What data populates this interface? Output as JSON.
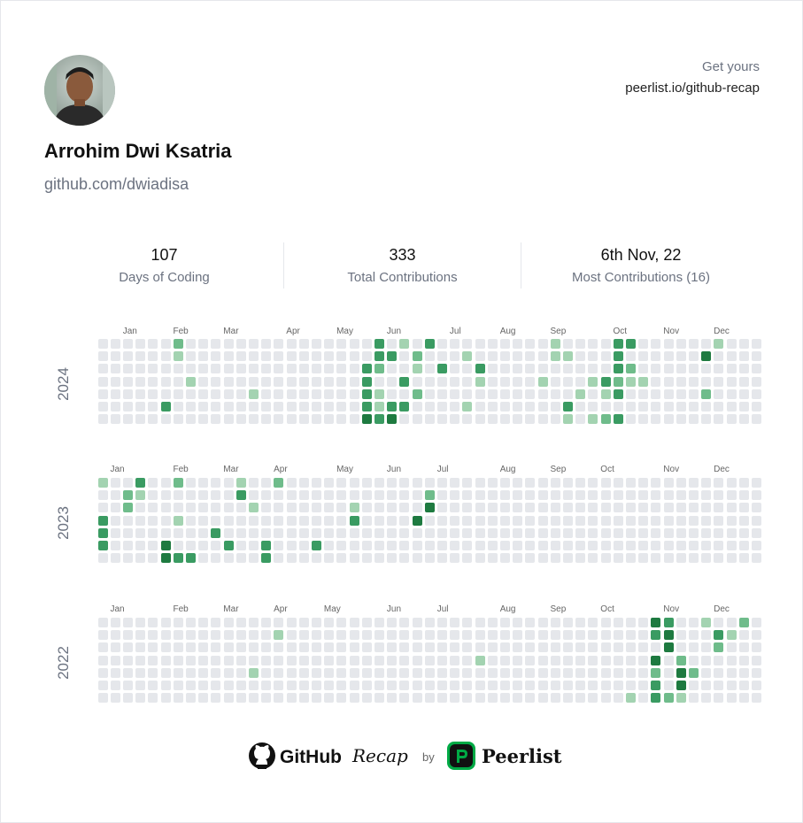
{
  "profile": {
    "name": "Arrohim Dwi Ksatria",
    "handle": "github.com/dwiadisa"
  },
  "promo": {
    "line1": "Get yours",
    "line2": "peerlist.io/github-recap"
  },
  "stats": [
    {
      "value": "107",
      "label": "Days of Coding"
    },
    {
      "value": "333",
      "label": "Total Contributions"
    },
    {
      "value": "6th Nov, 22",
      "label": "Most Contributions (16)"
    }
  ],
  "colors": {
    "empty": "#e5e7eb",
    "level1": "#a3d3b1",
    "level2": "#6fbc8b",
    "level3": "#3a9b62",
    "level4": "#1e7a40",
    "peerlist_green": "#00aa45"
  },
  "footer": {
    "github": "GitHub",
    "recap": "Recap",
    "by": "by",
    "peerlist": "Peerlist"
  },
  "years": [
    {
      "year": "2024",
      "months": [
        {
          "label": "Jan",
          "col": 1
        },
        {
          "label": "Feb",
          "col": 5
        },
        {
          "label": "Mar",
          "col": 9
        },
        {
          "label": "Apr",
          "col": 14
        },
        {
          "label": "May",
          "col": 18
        },
        {
          "label": "Jun",
          "col": 22
        },
        {
          "label": "Jul",
          "col": 27
        },
        {
          "label": "Aug",
          "col": 31
        },
        {
          "label": "Sep",
          "col": 35
        },
        {
          "label": "Oct",
          "col": 40
        },
        {
          "label": "Nov",
          "col": 44
        },
        {
          "label": "Dec",
          "col": 48
        }
      ],
      "active": [
        [
          0,
          6,
          2
        ],
        [
          1,
          6,
          1
        ],
        [
          5,
          5,
          3
        ],
        [
          3,
          7,
          1
        ],
        [
          4,
          12,
          1
        ],
        [
          0,
          22,
          3
        ],
        [
          1,
          22,
          3
        ],
        [
          2,
          21,
          3
        ],
        [
          3,
          21,
          3
        ],
        [
          4,
          21,
          3
        ],
        [
          5,
          21,
          3
        ],
        [
          6,
          21,
          4
        ],
        [
          2,
          22,
          2
        ],
        [
          4,
          22,
          1
        ],
        [
          5,
          22,
          1
        ],
        [
          6,
          22,
          3
        ],
        [
          1,
          23,
          3
        ],
        [
          5,
          23,
          3
        ],
        [
          6,
          23,
          4
        ],
        [
          3,
          24,
          3
        ],
        [
          0,
          24,
          1
        ],
        [
          5,
          24,
          3
        ],
        [
          1,
          25,
          2
        ],
        [
          2,
          25,
          1
        ],
        [
          4,
          25,
          2
        ],
        [
          0,
          26,
          3
        ],
        [
          2,
          27,
          3
        ],
        [
          1,
          29,
          1
        ],
        [
          5,
          29,
          1
        ],
        [
          2,
          30,
          3
        ],
        [
          3,
          30,
          1
        ],
        [
          3,
          35,
          1
        ],
        [
          0,
          36,
          1
        ],
        [
          1,
          36,
          1
        ],
        [
          5,
          37,
          3
        ],
        [
          6,
          37,
          1
        ],
        [
          1,
          37,
          1
        ],
        [
          4,
          38,
          1
        ],
        [
          3,
          39,
          1
        ],
        [
          6,
          39,
          1
        ],
        [
          4,
          40,
          1
        ],
        [
          6,
          40,
          2
        ],
        [
          3,
          40,
          3
        ],
        [
          0,
          41,
          3
        ],
        [
          1,
          41,
          3
        ],
        [
          2,
          41,
          3
        ],
        [
          3,
          41,
          2
        ],
        [
          4,
          41,
          3
        ],
        [
          6,
          41,
          3
        ],
        [
          0,
          42,
          3
        ],
        [
          2,
          42,
          2
        ],
        [
          3,
          42,
          1
        ],
        [
          3,
          43,
          1
        ],
        [
          0,
          49,
          1
        ],
        [
          1,
          48,
          4
        ],
        [
          4,
          48,
          2
        ]
      ]
    },
    {
      "year": "2023",
      "months": [
        {
          "label": "Jan",
          "col": 0
        },
        {
          "label": "Feb",
          "col": 5
        },
        {
          "label": "Mar",
          "col": 9
        },
        {
          "label": "Apr",
          "col": 13
        },
        {
          "label": "May",
          "col": 18
        },
        {
          "label": "Jun",
          "col": 22
        },
        {
          "label": "Jul",
          "col": 26
        },
        {
          "label": "Aug",
          "col": 31
        },
        {
          "label": "Sep",
          "col": 35
        },
        {
          "label": "Oct",
          "col": 39
        },
        {
          "label": "Nov",
          "col": 44
        },
        {
          "label": "Dec",
          "col": 48
        }
      ],
      "active": [
        [
          0,
          0,
          1
        ],
        [
          3,
          0,
          3
        ],
        [
          4,
          0,
          3
        ],
        [
          5,
          0,
          3
        ],
        [
          1,
          2,
          2
        ],
        [
          2,
          2,
          2
        ],
        [
          1,
          3,
          1
        ],
        [
          0,
          3,
          3
        ],
        [
          5,
          5,
          4
        ],
        [
          6,
          5,
          4
        ],
        [
          0,
          6,
          2
        ],
        [
          3,
          6,
          1
        ],
        [
          6,
          6,
          3
        ],
        [
          6,
          7,
          3
        ],
        [
          4,
          9,
          3
        ],
        [
          5,
          10,
          3
        ],
        [
          0,
          11,
          1
        ],
        [
          1,
          11,
          3
        ],
        [
          2,
          12,
          1
        ],
        [
          5,
          13,
          3
        ],
        [
          6,
          13,
          3
        ],
        [
          0,
          14,
          2
        ],
        [
          5,
          17,
          3
        ],
        [
          2,
          20,
          1
        ],
        [
          3,
          20,
          3
        ],
        [
          3,
          25,
          4
        ],
        [
          1,
          26,
          2
        ],
        [
          2,
          26,
          4
        ]
      ]
    },
    {
      "year": "2022",
      "months": [
        {
          "label": "Jan",
          "col": 0
        },
        {
          "label": "Feb",
          "col": 5
        },
        {
          "label": "Mar",
          "col": 9
        },
        {
          "label": "Apr",
          "col": 13
        },
        {
          "label": "May",
          "col": 17
        },
        {
          "label": "Jun",
          "col": 22
        },
        {
          "label": "Jul",
          "col": 26
        },
        {
          "label": "Aug",
          "col": 31
        },
        {
          "label": "Sep",
          "col": 35
        },
        {
          "label": "Oct",
          "col": 39
        },
        {
          "label": "Nov",
          "col": 44
        },
        {
          "label": "Dec",
          "col": 48
        }
      ],
      "active": [
        [
          1,
          14,
          1
        ],
        [
          4,
          12,
          1
        ],
        [
          3,
          30,
          1
        ],
        [
          6,
          42,
          1
        ],
        [
          0,
          44,
          4
        ],
        [
          1,
          44,
          3
        ],
        [
          3,
          44,
          4
        ],
        [
          4,
          44,
          2
        ],
        [
          5,
          44,
          3
        ],
        [
          6,
          44,
          3
        ],
        [
          0,
          45,
          3
        ],
        [
          1,
          45,
          4
        ],
        [
          2,
          45,
          4
        ],
        [
          6,
          45,
          2
        ],
        [
          3,
          46,
          2
        ],
        [
          4,
          46,
          4
        ],
        [
          5,
          46,
          4
        ],
        [
          6,
          46,
          1
        ],
        [
          4,
          47,
          2
        ],
        [
          0,
          48,
          1
        ],
        [
          1,
          49,
          3
        ],
        [
          2,
          49,
          2
        ],
        [
          1,
          50,
          1
        ],
        [
          0,
          51,
          2
        ]
      ]
    }
  ]
}
